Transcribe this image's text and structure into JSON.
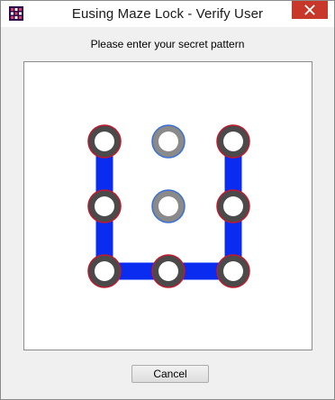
{
  "window": {
    "title": "Eusing Maze Lock - Verify User",
    "icon": "maze-lock-app-icon",
    "close_icon": "close-icon",
    "colors": {
      "close": "#c7382b",
      "path": "#0a2cf0",
      "node_ring_active": "#c0192e",
      "node_ring_idle": "#3a6fd6",
      "node_fill_active": "#4a4a4a",
      "node_fill_idle": "#8a8a8a"
    }
  },
  "prompt": {
    "text": "Please enter your secret pattern"
  },
  "pattern": {
    "grid": "3x3",
    "nodes": [
      {
        "id": 1,
        "selected": true
      },
      {
        "id": 2,
        "selected": false
      },
      {
        "id": 3,
        "selected": true
      },
      {
        "id": 4,
        "selected": true
      },
      {
        "id": 5,
        "selected": false
      },
      {
        "id": 6,
        "selected": true
      },
      {
        "id": 7,
        "selected": true
      },
      {
        "id": 8,
        "selected": true
      },
      {
        "id": 9,
        "selected": true
      }
    ],
    "sequence": [
      1,
      4,
      7,
      8,
      9,
      6,
      3
    ]
  },
  "buttons": {
    "cancel": "Cancel"
  }
}
